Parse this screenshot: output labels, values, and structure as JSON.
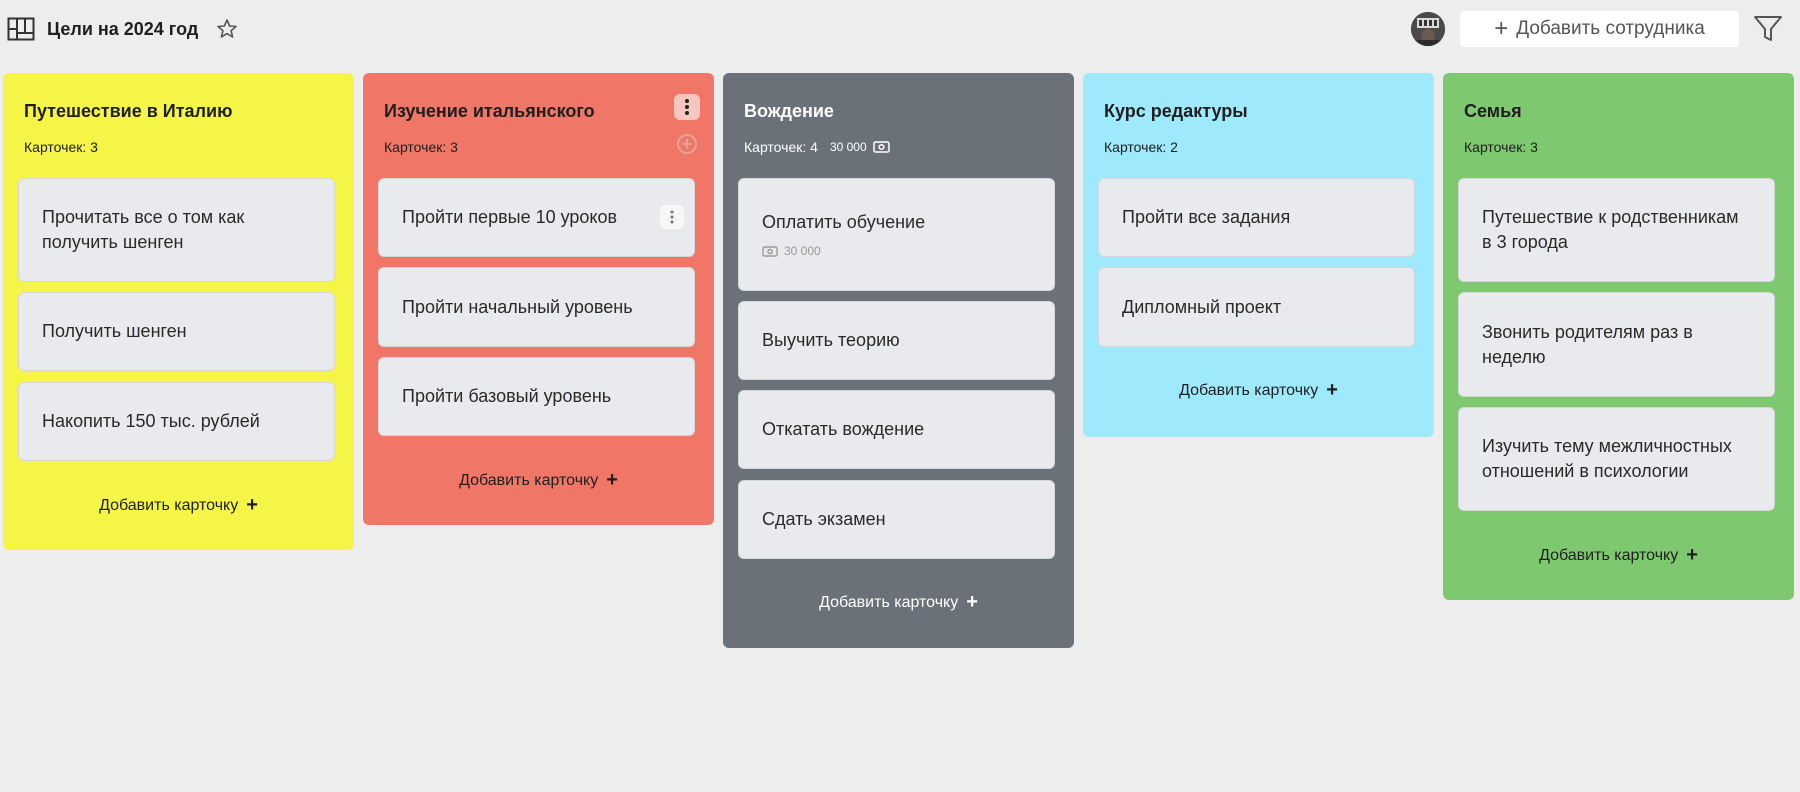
{
  "header": {
    "title": "Цели на 2024 год",
    "add_employee_label": "Добавить сотрудника",
    "icons": [
      "board-icon",
      "star-icon",
      "avatar",
      "filter-icon"
    ]
  },
  "columns": [
    {
      "title": "Путешествие в Италию",
      "count_label": "Карточек: 3",
      "color": "#f5f548",
      "cards": [
        {
          "text": "Прочитать все о том как получить шенген"
        },
        {
          "text": "Получить шенген"
        },
        {
          "text": "Накопить 150 тыс. рублей"
        }
      ],
      "add_label": "Добавить карточку"
    },
    {
      "title": "Изучение итальянского",
      "count_label": "Карточек: 3",
      "color": "#f07768",
      "cards": [
        {
          "text": "Пройти первые 10 уроков"
        },
        {
          "text": "Пройти начальный уровень"
        },
        {
          "text": "Пройти базовый уровень"
        }
      ],
      "add_label": "Добавить карточку"
    },
    {
      "title": "Вождение",
      "count_label": "Карточек: 4",
      "sum_label": "30 000",
      "color": "#6b7179",
      "cards": [
        {
          "text": "Оплатить обучение",
          "sub": "30 000"
        },
        {
          "text": "Выучить теорию"
        },
        {
          "text": "Откатать вождение"
        },
        {
          "text": "Сдать экзамен"
        }
      ],
      "add_label": "Добавить карточку"
    },
    {
      "title": "Курс редактуры",
      "count_label": "Карточек: 2",
      "color": "#9eeafc",
      "cards": [
        {
          "text": "Пройти все задания"
        },
        {
          "text": "Дипломный проект"
        }
      ],
      "add_label": "Добавить карточку"
    },
    {
      "title": "Семья",
      "count_label": "Карточек: 3",
      "color": "#7ec870",
      "cards": [
        {
          "text": "Путешествие к родственникам в 3 города"
        },
        {
          "text": "Звонить родителям раз в неделю"
        },
        {
          "text": "Изучить тему межличностных отношений в психологии"
        }
      ],
      "add_label": "Добавить карточку"
    }
  ]
}
